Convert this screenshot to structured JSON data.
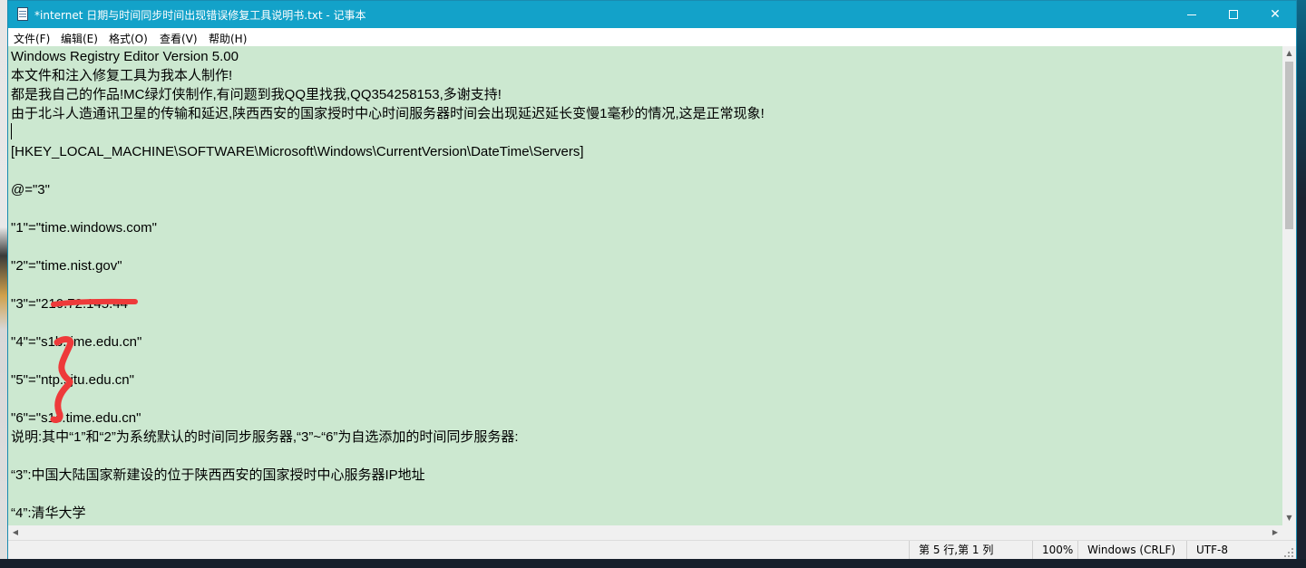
{
  "window": {
    "title": "*internet 日期与时间同步时间出现错误修复工具说明书.txt - 记事本",
    "minimize_icon": "minimize-icon",
    "maximize_icon": "maximize-icon",
    "close_icon": "close-icon",
    "close_glyph": "✕"
  },
  "menu": {
    "file": "文件(F)",
    "edit": "编辑(E)",
    "format": "格式(O)",
    "view": "查看(V)",
    "help": "帮助(H)"
  },
  "editor": {
    "background": "#cce8d0",
    "lines": [
      "Windows Registry Editor Version 5.00",
      "本文件和注入修复工具为我本人制作!",
      "都是我自己的作品!MC绿灯侠制作,有问题到我QQ里找我,QQ354258153,多谢支持!",
      "由于北斗人造通讯卫星的传输和延迟,陕西西安的国家授时中心时间服务器时间会出现延迟延长变慢1毫秒的情况,这是正常现象!",
      "",
      "[HKEY_LOCAL_MACHINE\\SOFTWARE\\Microsoft\\Windows\\CurrentVersion\\DateTime\\Servers]",
      "",
      "@=\"3\"",
      "",
      "\"1\"=\"time.windows.com\"",
      "",
      "\"2\"=\"time.nist.gov\"",
      "",
      "\"3\"=\"210.72.145.44\"",
      "",
      "\"4\"=\"s1b.time.edu.cn\"",
      "",
      "\"5\"=\"ntp.sjtu.edu.cn\"",
      "",
      "\"6\"=\"s1c.time.edu.cn\"",
      "说明:其中“1”和“2”为系统默认的时间同步服务器,“3”~“6”为自选添加的时间同步服务器:",
      "",
      "“3”:中国大陆国家新建设的位于陕西西安的国家授时中心服务器IP地址",
      "",
      "“4”:清华大学"
    ]
  },
  "status": {
    "position": "第 5 行,第 1 列",
    "zoom": "100%",
    "line_ending": "Windows (CRLF)",
    "encoding": "UTF-8"
  },
  "scroll": {
    "up_glyph": "▲",
    "down_glyph": "▼",
    "left_glyph": "◀",
    "right_glyph": "▶"
  },
  "annotation_color": "#ee3a3a"
}
